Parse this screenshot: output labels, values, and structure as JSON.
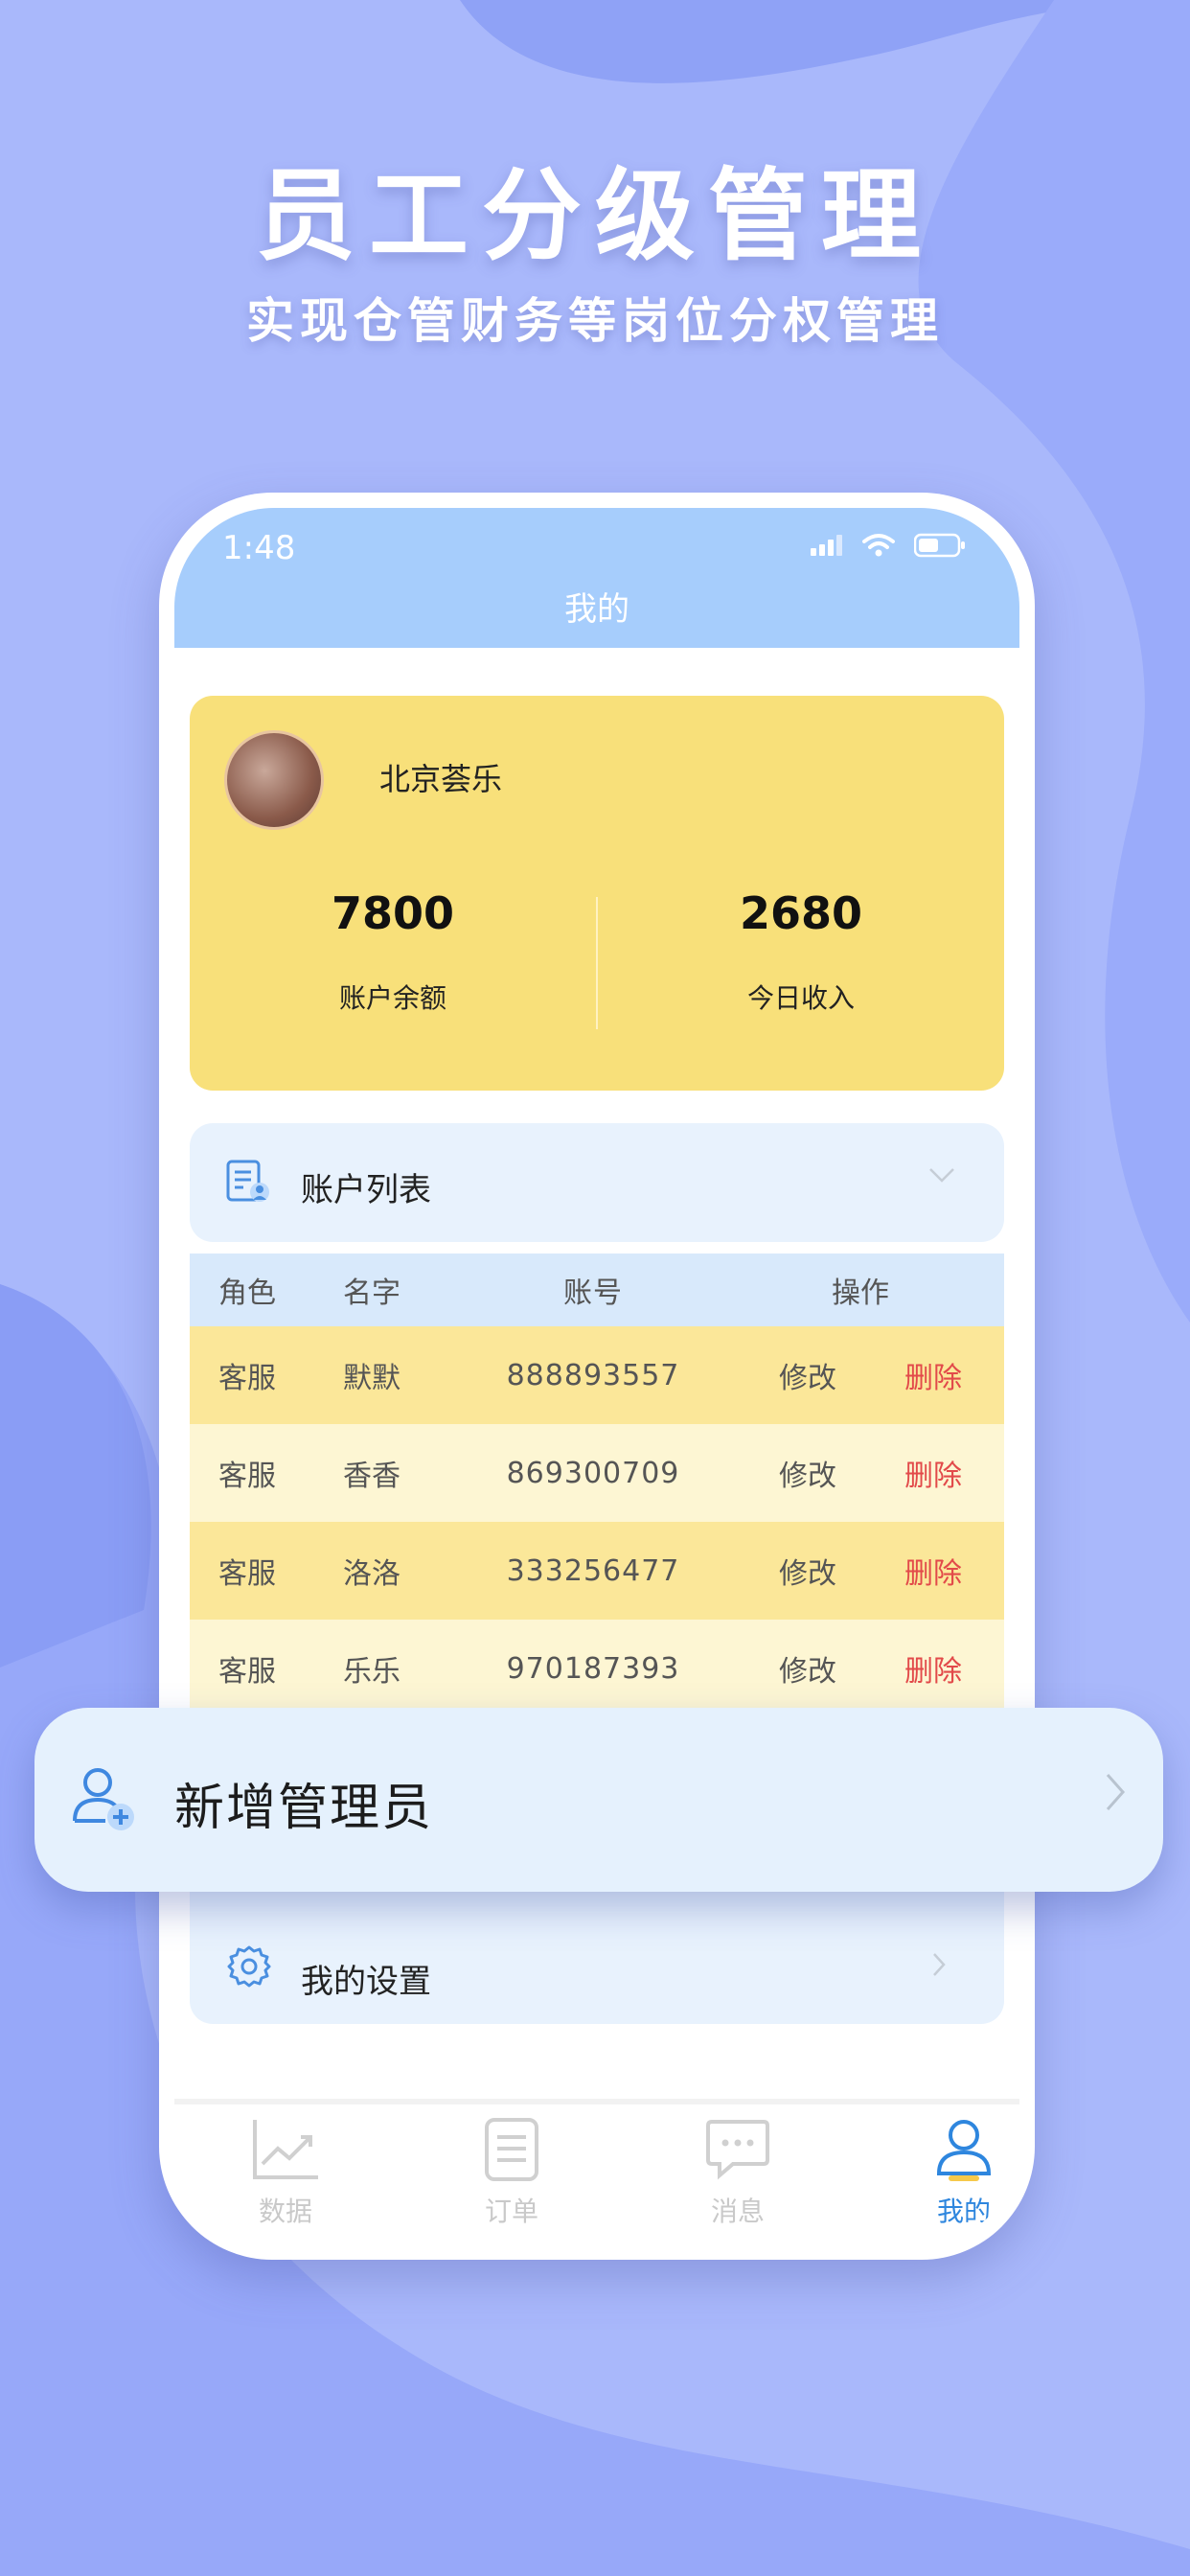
{
  "promo": {
    "headline": "员工分级管理",
    "subline": "实现仓管财务等岗位分权管理"
  },
  "status_bar": {
    "time": "1:48"
  },
  "nav": {
    "title": "我的"
  },
  "profile": {
    "name": "北京荟乐",
    "balance_value": "7800",
    "balance_label": "账户余额",
    "income_value": "2680",
    "income_label": "今日收入"
  },
  "accounts": {
    "title": "账户列表",
    "headers": {
      "role": "角色",
      "name": "名字",
      "account": "账号",
      "action": "操作"
    },
    "rows": [
      {
        "role": "客服",
        "name": "默默",
        "account": "888893557",
        "edit": "修改",
        "delete": "删除"
      },
      {
        "role": "客服",
        "name": "香香",
        "account": "869300709",
        "edit": "修改",
        "delete": "删除"
      },
      {
        "role": "客服",
        "name": "洛洛",
        "account": "333256477",
        "edit": "修改",
        "delete": "删除"
      },
      {
        "role": "客服",
        "name": "乐乐",
        "account": "970187393",
        "edit": "修改",
        "delete": "删除"
      }
    ]
  },
  "floating_item": {
    "label": "新增管理员"
  },
  "settings": {
    "label": "我的设置"
  },
  "tabbar": {
    "items": [
      {
        "label": "数据",
        "icon": "chart-icon"
      },
      {
        "label": "订单",
        "icon": "document-icon"
      },
      {
        "label": "消息",
        "icon": "message-icon"
      },
      {
        "label": "我的",
        "icon": "user-icon"
      }
    ],
    "active_index": 3
  },
  "colors": {
    "background": "#a9b8fb",
    "header": "#a6cdfc",
    "profile_card": "#f8e07a",
    "delete": "#e24a4a",
    "active_tab": "#2e86de"
  }
}
